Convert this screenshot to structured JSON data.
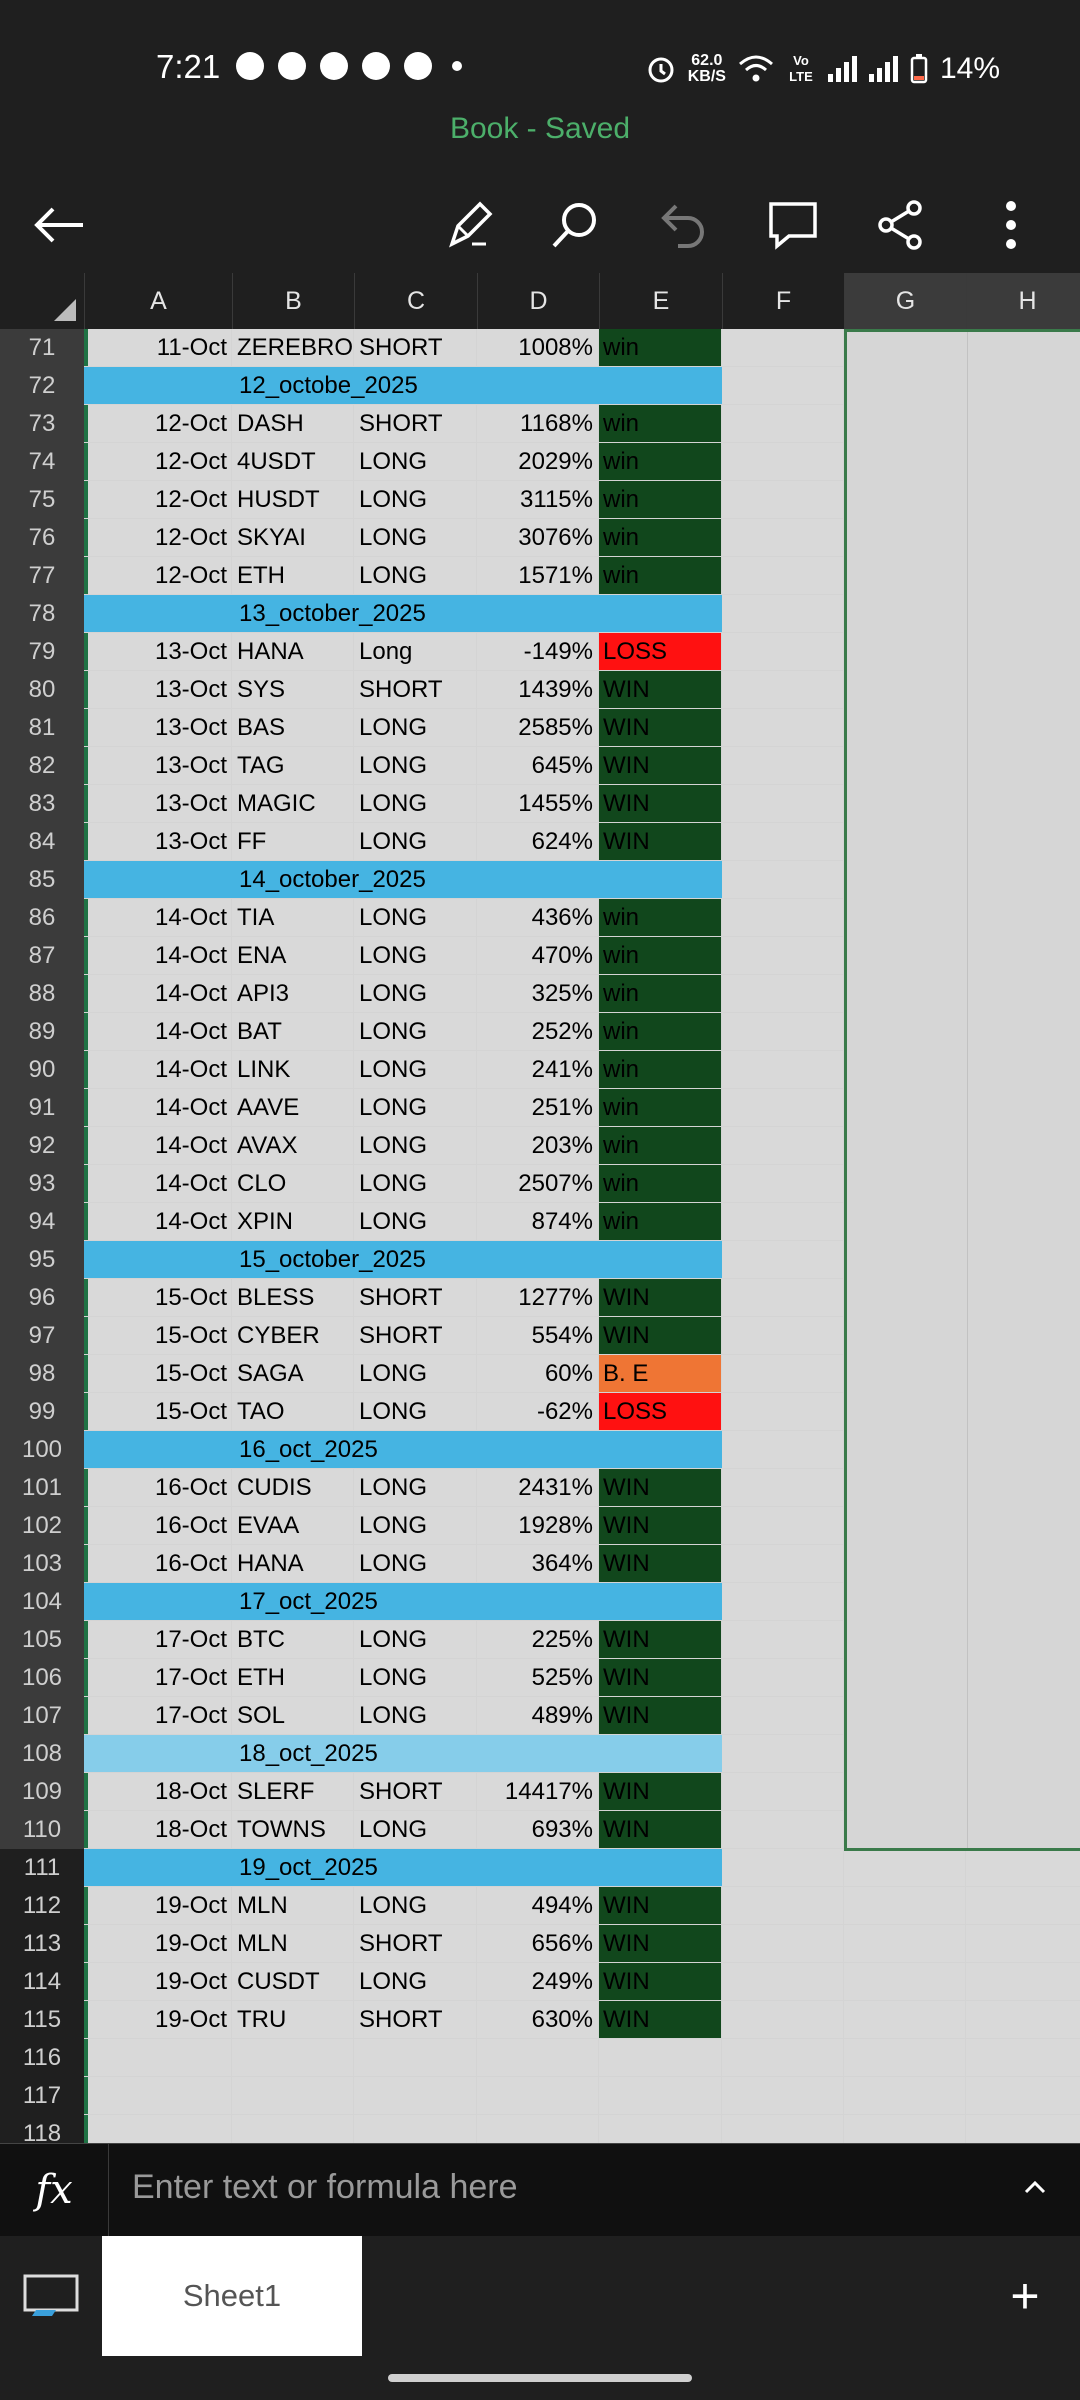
{
  "status_bar": {
    "time": "7:21",
    "notification_icons": [
      "facebook-icon",
      "discord-icon",
      "messenger-icon",
      "telegram-icon",
      "whatsapp-icon"
    ],
    "net_speed": "62.0",
    "net_unit": "KB/S",
    "volte": "Vo LTE",
    "battery": "14%"
  },
  "title": "Book - Saved",
  "toolbar": {
    "icons": [
      "back-arrow-icon",
      "pen-icon",
      "search-icon",
      "undo-icon",
      "comment-icon",
      "share-icon",
      "more-icon"
    ]
  },
  "columns": [
    "A",
    "B",
    "C",
    "D",
    "E",
    "F",
    "G",
    "H"
  ],
  "rows": [
    {
      "n": "71",
      "date": "11-Oct",
      "coin": "ZEREBRO",
      "side": "SHORT",
      "pct": "1008%",
      "result": "win",
      "kind": "win"
    },
    {
      "n": "72",
      "section": "12_octobe_2025"
    },
    {
      "n": "73",
      "date": "12-Oct",
      "coin": "DASH",
      "side": "SHORT",
      "pct": "1168%",
      "result": "win",
      "kind": "win"
    },
    {
      "n": "74",
      "date": "12-Oct",
      "coin": "4USDT",
      "side": "LONG",
      "pct": "2029%",
      "result": "win",
      "kind": "win"
    },
    {
      "n": "75",
      "date": "12-Oct",
      "coin": "HUSDT",
      "side": "LONG",
      "pct": "3115%",
      "result": "win",
      "kind": "win"
    },
    {
      "n": "76",
      "date": "12-Oct",
      "coin": "SKYAI",
      "side": "LONG",
      "pct": "3076%",
      "result": "win",
      "kind": "win"
    },
    {
      "n": "77",
      "date": "12-Oct",
      "coin": "ETH",
      "side": "LONG",
      "pct": "1571%",
      "result": "win",
      "kind": "win"
    },
    {
      "n": "78",
      "section": "13_october_2025"
    },
    {
      "n": "79",
      "date": "13-Oct",
      "coin": "HANA",
      "side": "Long",
      "pct": "-149%",
      "result": "LOSS",
      "kind": "loss"
    },
    {
      "n": "80",
      "date": "13-Oct",
      "coin": "SYS",
      "side": "SHORT",
      "pct": "1439%",
      "result": "WIN",
      "kind": "win"
    },
    {
      "n": "81",
      "date": "13-Oct",
      "coin": "BAS",
      "side": "LONG",
      "pct": "2585%",
      "result": "WIN",
      "kind": "win"
    },
    {
      "n": "82",
      "date": "13-Oct",
      "coin": "TAG",
      "side": "LONG",
      "pct": "645%",
      "result": "WIN",
      "kind": "win"
    },
    {
      "n": "83",
      "date": "13-Oct",
      "coin": "MAGIC",
      "side": "LONG",
      "pct": "1455%",
      "result": "WIN",
      "kind": "win"
    },
    {
      "n": "84",
      "date": "13-Oct",
      "coin": "FF",
      "side": "LONG",
      "pct": "624%",
      "result": "WIN",
      "kind": "win"
    },
    {
      "n": "85",
      "section": "14_october_2025"
    },
    {
      "n": "86",
      "date": "14-Oct",
      "coin": "TIA",
      "side": "LONG",
      "pct": "436%",
      "result": "win",
      "kind": "win"
    },
    {
      "n": "87",
      "date": "14-Oct",
      "coin": "ENA",
      "side": "LONG",
      "pct": "470%",
      "result": "win",
      "kind": "win"
    },
    {
      "n": "88",
      "date": "14-Oct",
      "coin": "API3",
      "side": "LONG",
      "pct": "325%",
      "result": "win",
      "kind": "win"
    },
    {
      "n": "89",
      "date": "14-Oct",
      "coin": "BAT",
      "side": "LONG",
      "pct": "252%",
      "result": "win",
      "kind": "win"
    },
    {
      "n": "90",
      "date": "14-Oct",
      "coin": "LINK",
      "side": "LONG",
      "pct": "241%",
      "result": "win",
      "kind": "win"
    },
    {
      "n": "91",
      "date": "14-Oct",
      "coin": "AAVE",
      "side": "LONG",
      "pct": "251%",
      "result": "win",
      "kind": "win"
    },
    {
      "n": "92",
      "date": "14-Oct",
      "coin": "AVAX",
      "side": "LONG",
      "pct": "203%",
      "result": "win",
      "kind": "win"
    },
    {
      "n": "93",
      "date": "14-Oct",
      "coin": "CLO",
      "side": "LONG",
      "pct": "2507%",
      "result": "win",
      "kind": "win"
    },
    {
      "n": "94",
      "date": "14-Oct",
      "coin": "XPIN",
      "side": "LONG",
      "pct": "874%",
      "result": "win",
      "kind": "win"
    },
    {
      "n": "95",
      "section": "15_october_2025"
    },
    {
      "n": "96",
      "date": "15-Oct",
      "coin": "BLESS",
      "side": "SHORT",
      "pct": "1277%",
      "result": "WIN",
      "kind": "win"
    },
    {
      "n": "97",
      "date": "15-Oct",
      "coin": "CYBER",
      "side": "SHORT",
      "pct": "554%",
      "result": "WIN",
      "kind": "win"
    },
    {
      "n": "98",
      "date": "15-Oct",
      "coin": "SAGA",
      "side": "LONG",
      "pct": "60%",
      "result": "B. E",
      "kind": "be"
    },
    {
      "n": "99",
      "date": "15-Oct",
      "coin": "TAO",
      "side": "LONG",
      "pct": "-62%",
      "result": "LOSS",
      "kind": "loss"
    },
    {
      "n": "100",
      "section": "16_oct_2025"
    },
    {
      "n": "101",
      "date": "16-Oct",
      "coin": "CUDIS",
      "side": "LONG",
      "pct": "2431%",
      "result": "WIN",
      "kind": "win"
    },
    {
      "n": "102",
      "date": "16-Oct",
      "coin": "EVAA",
      "side": "LONG",
      "pct": "1928%",
      "result": "WIN",
      "kind": "win"
    },
    {
      "n": "103",
      "date": "16-Oct",
      "coin": "HANA",
      "side": "LONG",
      "pct": "364%",
      "result": "WIN",
      "kind": "win"
    },
    {
      "n": "104",
      "section": "17_oct_2025"
    },
    {
      "n": "105",
      "date": "17-Oct",
      "coin": "BTC",
      "side": "LONG",
      "pct": "225%",
      "result": "WIN",
      "kind": "win"
    },
    {
      "n": "106",
      "date": "17-Oct",
      "coin": "ETH",
      "side": "LONG",
      "pct": "525%",
      "result": "WIN",
      "kind": "win"
    },
    {
      "n": "107",
      "date": "17-Oct",
      "coin": "SOL",
      "side": "LONG",
      "pct": "489%",
      "result": "WIN",
      "kind": "win"
    },
    {
      "n": "108",
      "section": "18_oct_2025",
      "light": true
    },
    {
      "n": "109",
      "date": "18-Oct",
      "coin": "SLERF",
      "side": "SHORT",
      "pct": "14417%",
      "result": "WIN",
      "kind": "win"
    },
    {
      "n": "110",
      "date": "18-Oct",
      "coin": "TOWNS",
      "side": "LONG",
      "pct": "693%",
      "result": "WIN",
      "kind": "win"
    },
    {
      "n": "111",
      "section": "19_oct_2025"
    },
    {
      "n": "112",
      "date": "19-Oct",
      "coin": "MLN",
      "side": "LONG",
      "pct": "494%",
      "result": "WIN",
      "kind": "win"
    },
    {
      "n": "113",
      "date": "19-Oct",
      "coin": "MLN",
      "side": "SHORT",
      "pct": "656%",
      "result": "WIN",
      "kind": "win"
    },
    {
      "n": "114",
      "date": "19-Oct",
      "coin": "CUSDT",
      "side": "LONG",
      "pct": "249%",
      "result": "WIN",
      "kind": "win"
    },
    {
      "n": "115",
      "date": "19-Oct",
      "coin": "TRU",
      "side": "SHORT",
      "pct": "630%",
      "result": "WIN",
      "kind": "win"
    },
    {
      "n": "116"
    },
    {
      "n": "117"
    },
    {
      "n": "118"
    }
  ],
  "formula_bar": {
    "label": "fx",
    "placeholder": "Enter text or formula here"
  },
  "sheet_tabs": [
    "Sheet1"
  ],
  "add_sheet_label": "+",
  "colors": {
    "title_green": "#4caf6a",
    "section_blue": "#45b4e2",
    "win_green": "#11471c",
    "loss_red": "#ff1111",
    "breakeven_orange": "#ef7534"
  }
}
